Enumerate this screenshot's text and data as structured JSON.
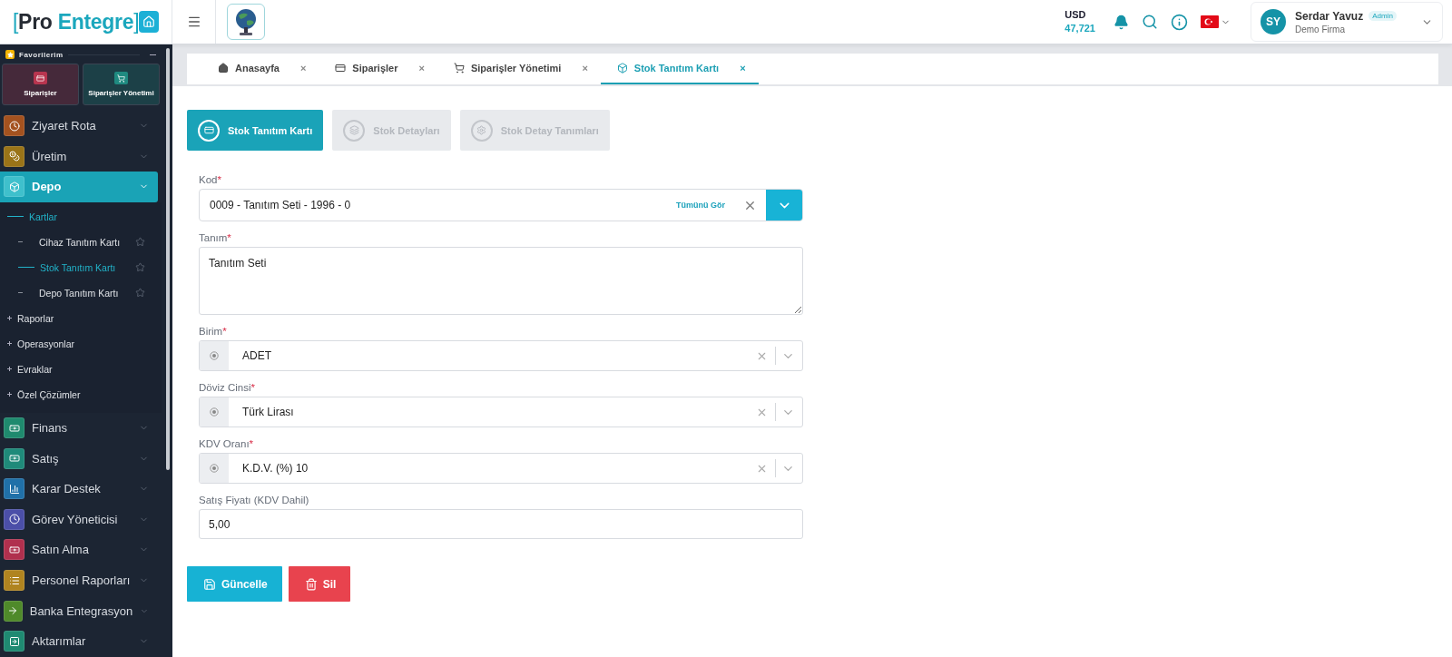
{
  "header": {
    "brand": {
      "open": "[",
      "first": "Pro",
      "second": "Entegre",
      "close": "]"
    },
    "currency": {
      "code": "USD",
      "rate": "47,721"
    },
    "user": {
      "initials": "SY",
      "name": "Serdar Yavuz",
      "role": "Admin",
      "company": "Demo Firma"
    }
  },
  "sidebar": {
    "favorites": {
      "title": "Favorilerim",
      "items": [
        {
          "label": "Siparişler",
          "color": "#b8354f"
        },
        {
          "label": "Siparişler Yönetimi",
          "color": "#1f8a80"
        }
      ]
    },
    "menu": [
      {
        "label": "Ziyaret Rota",
        "color": "#a4521f",
        "selected": false
      },
      {
        "label": "Üretim",
        "color": "#9a7418",
        "selected": false
      },
      {
        "label": "Depo",
        "color": "#3fc0cc",
        "selected": true,
        "children": [
          {
            "label": "Kartlar",
            "selected": true,
            "expanded": true,
            "children": [
              {
                "label": "Cihaz Tanıtım Kartı",
                "selected": false
              },
              {
                "label": "Stok Tanıtım Kartı",
                "selected": true
              },
              {
                "label": "Depo Tanıtım Kartı",
                "selected": false
              }
            ]
          },
          {
            "label": "Raporlar",
            "selected": false,
            "expanded": false
          },
          {
            "label": "Operasyonlar",
            "selected": false,
            "expanded": false
          },
          {
            "label": "Evraklar",
            "selected": false,
            "expanded": false
          },
          {
            "label": "Özel Çözümler",
            "selected": false,
            "expanded": false
          }
        ]
      },
      {
        "label": "Finans",
        "color": "#1f8a6e",
        "selected": false
      },
      {
        "label": "Satış",
        "color": "#1f8a7a",
        "selected": false
      },
      {
        "label": "Karar Destek",
        "color": "#2070a8",
        "selected": false
      },
      {
        "label": "Görev Yöneticisi",
        "color": "#4b4fa8",
        "selected": false
      },
      {
        "label": "Satın Alma",
        "color": "#b0304e",
        "selected": false
      },
      {
        "label": "Personel Raporları",
        "color": "#b08420",
        "selected": false
      },
      {
        "label": "Banka Entegrasyon",
        "color": "#4f8a2a",
        "selected": false
      },
      {
        "label": "Aktarımlar",
        "color": "#1f8a72",
        "selected": false
      }
    ]
  },
  "tabs": [
    {
      "label": "Anasayfa",
      "selected": false,
      "close": "×"
    },
    {
      "label": "Siparişler",
      "selected": false,
      "close": "×"
    },
    {
      "label": "Siparişler Yönetimi",
      "selected": false,
      "close": "×"
    },
    {
      "label": "Stok Tanıtım Kartı",
      "selected": true,
      "close": "×"
    }
  ],
  "steps": [
    {
      "label": "Stok Tanıtım Kartı",
      "selected": true
    },
    {
      "label": "Stok Detayları",
      "selected": false
    },
    {
      "label": "Stok Detay Tanımları",
      "selected": false
    }
  ],
  "form": [
    {
      "kind": "combo",
      "label": "Kod",
      "mark": "*",
      "value": "0009 - Tanıtım Seti - 1996 - 0",
      "link": "Tümünü Gör"
    },
    {
      "kind": "textarea",
      "label": "Tanım",
      "mark": "*",
      "value": "Tanıtım Seti"
    },
    {
      "kind": "select",
      "label": "Birim",
      "mark": "*",
      "value": "ADET"
    },
    {
      "kind": "select",
      "label": "Döviz Cinsi",
      "mark": "*",
      "value": "Türk Lirası"
    },
    {
      "kind": "select",
      "label": "KDV Oranı",
      "mark": "*",
      "value": "K.D.V. (%) 10"
    },
    {
      "kind": "input",
      "label": "Satış Fiyatı (KDV Dahil)",
      "value": "5,00"
    }
  ],
  "actions": [
    {
      "label": "Güncelle",
      "kind": "primary"
    },
    {
      "label": "Sil",
      "kind": "danger"
    }
  ]
}
